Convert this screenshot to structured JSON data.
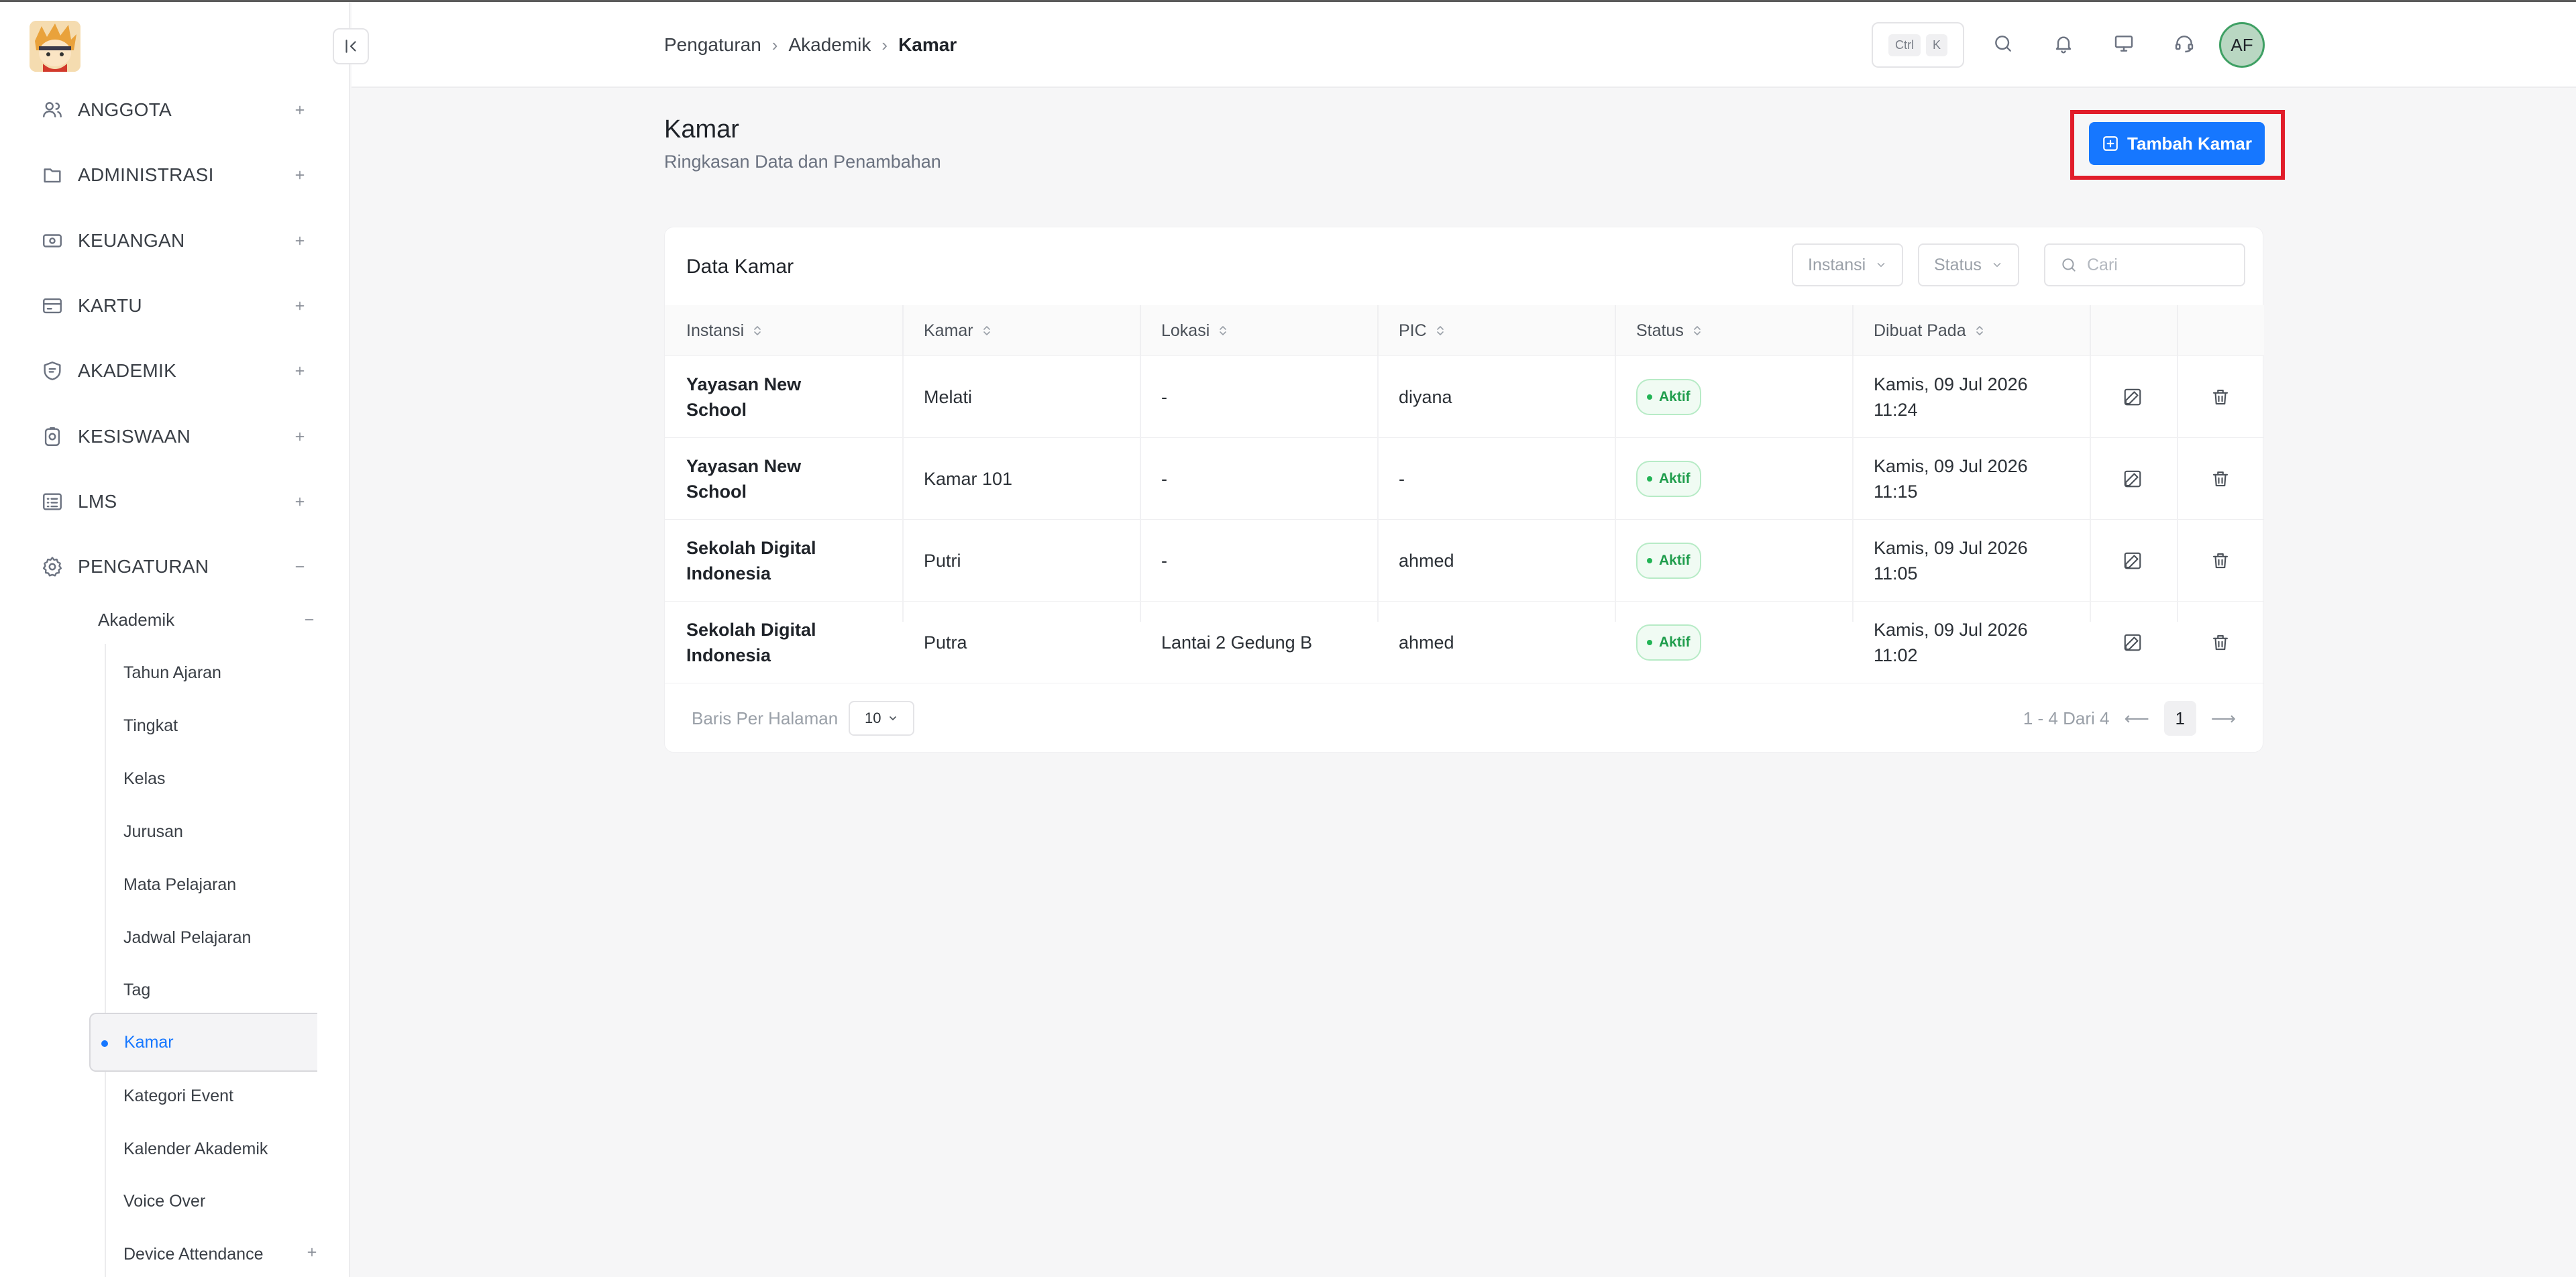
{
  "sidebar": {
    "items": [
      {
        "label": "ANGGOTA",
        "icon": "users-icon",
        "state": "+"
      },
      {
        "label": "ADMINISTRASI",
        "icon": "folder-icon",
        "state": "+"
      },
      {
        "label": "KEUANGAN",
        "icon": "money-icon",
        "state": "+"
      },
      {
        "label": "KARTU",
        "icon": "card-icon",
        "state": "+"
      },
      {
        "label": "AKADEMIK",
        "icon": "shield-book-icon",
        "state": "+"
      },
      {
        "label": "KESISWAAN",
        "icon": "badge-icon",
        "state": "+"
      },
      {
        "label": "LMS",
        "icon": "list-icon",
        "state": "+"
      },
      {
        "label": "PENGATURAN",
        "icon": "gear-icon",
        "state": "−"
      }
    ],
    "submenu": {
      "label": "Akademik",
      "state": "−"
    },
    "leaves": [
      "Tahun Ajaran",
      "Tingkat",
      "Kelas",
      "Jurusan",
      "Mata Pelajaran",
      "Jadwal Pelajaran",
      "Tag",
      "Kamar",
      "Kategori Event",
      "Kalender Akademik",
      "Voice Over",
      "Device Attendance"
    ],
    "active_leaf": "Kamar",
    "last_item_state": "+"
  },
  "header": {
    "breadcrumb": [
      "Pengaturan",
      "Akademik",
      "Kamar"
    ],
    "shortcut": {
      "key1": "Ctrl",
      "key2": "K"
    },
    "avatar_initials": "AF"
  },
  "page": {
    "title": "Kamar",
    "subtitle": "Ringkasan Data dan Penambahan",
    "add_button": "Tambah Kamar"
  },
  "card": {
    "title": "Data Kamar",
    "filters": {
      "instansi": "Instansi",
      "status": "Status"
    },
    "search_placeholder": "Cari",
    "columns": [
      "Instansi",
      "Kamar",
      "Lokasi",
      "PIC",
      "Status",
      "Dibuat Pada"
    ],
    "rows": [
      {
        "instansi": "Yayasan New School",
        "kamar": "Melati",
        "lokasi": "-",
        "pic": "diyana",
        "status": "Aktif",
        "dibuat": "Kamis, 09 Jul 2026 11:24"
      },
      {
        "instansi": "Yayasan New School",
        "kamar": "Kamar 101",
        "lokasi": "-",
        "pic": "-",
        "status": "Aktif",
        "dibuat": "Kamis, 09 Jul 2026 11:15"
      },
      {
        "instansi": "Sekolah Digital Indonesia",
        "kamar": "Putri",
        "lokasi": "-",
        "pic": "ahmed",
        "status": "Aktif",
        "dibuat": "Kamis, 09 Jul 2026 11:05"
      },
      {
        "instansi": "Sekolah Digital Indonesia",
        "kamar": "Putra",
        "lokasi": "Lantai 2 Gedung B",
        "pic": "ahmed",
        "status": "Aktif",
        "dibuat": "Kamis, 09 Jul 2026 11:02"
      }
    ],
    "rows_per_page_label": "Baris Per Halaman",
    "rows_per_page": "10",
    "range_text": "1 - 4 Dari 4",
    "current_page": "1"
  },
  "colors": {
    "accent": "#1677ff",
    "success": "#1f9d4c",
    "highlight": "#e11d2a"
  }
}
